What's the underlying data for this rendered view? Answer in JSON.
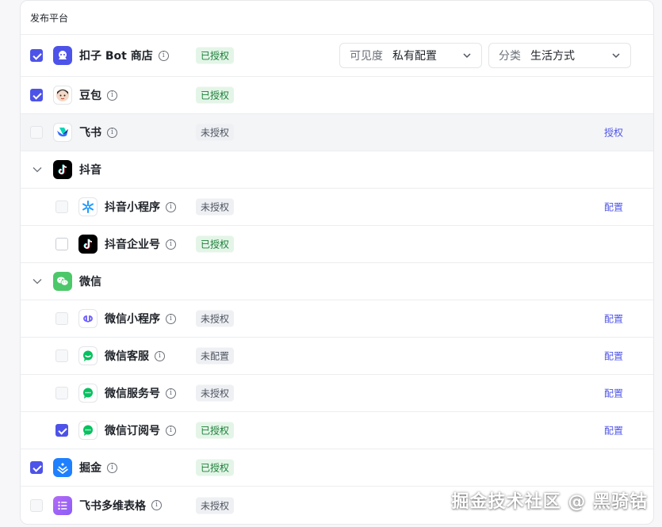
{
  "header": {
    "title": "发布平台"
  },
  "colors": {
    "accent": "#4d53e8",
    "authorized_bg": "#e4f5e8",
    "authorized_text": "#1a7f37",
    "unauthorized_bg": "#eef0f3"
  },
  "coze": {
    "name": "扣子 Bot 商店",
    "status": "已授权",
    "visibility": {
      "label": "可见度",
      "value": "私有配置"
    },
    "category": {
      "label": "分类",
      "value": "生活方式"
    }
  },
  "doubao": {
    "name": "豆包",
    "status": "已授权"
  },
  "feishu": {
    "name": "飞书",
    "status": "未授权",
    "action": "授权"
  },
  "douyin": {
    "group": "抖音",
    "miniapp": {
      "name": "抖音小程序",
      "status": "未授权",
      "action": "配置"
    },
    "enterprise": {
      "name": "抖音企业号",
      "status": "已授权"
    }
  },
  "wechat": {
    "group": "微信",
    "miniapp": {
      "name": "微信小程序",
      "status": "未授权",
      "action": "配置"
    },
    "service": {
      "name": "微信客服",
      "status": "未配置",
      "action": "配置"
    },
    "official": {
      "name": "微信服务号",
      "status": "未授权",
      "action": "配置"
    },
    "subscription": {
      "name": "微信订阅号",
      "status": "已授权",
      "action": "配置"
    }
  },
  "juejin": {
    "name": "掘金",
    "status": "已授权"
  },
  "feishu_bitable": {
    "name": "飞书多维表格",
    "status": "未授权"
  },
  "watermark": "掘金技术社区 @ 黑骑钴"
}
